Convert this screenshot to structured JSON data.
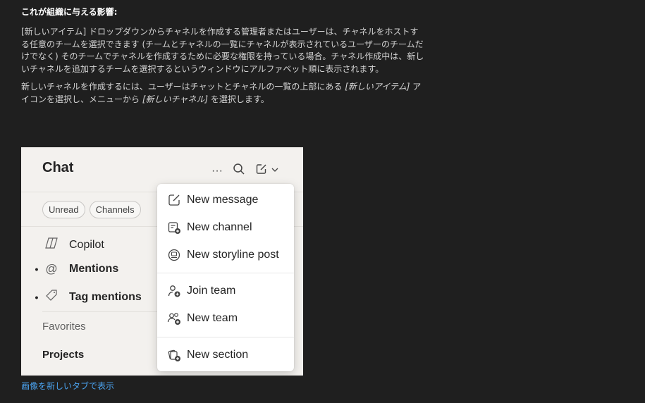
{
  "doc": {
    "heading": "これが組織に与える影響:",
    "para1": "[新しいアイテム] ドロップダウンからチャネルを作成する管理者またはユーザーは、チャネルをホストする任意のチームを選択できます (チームとチャネルの一覧にチャネルが表示されているユーザーのチームだけでなく) そのチームでチャネルを作成するために必要な権限を持っている場合。チャネル作成中は、新しいチャネルを追加するチームを選択するというウィンドウにアルファベット順に表示されます。",
    "para2_before": "新しいチャネルを作成するには、ユーザーはチャットとチャネルの一覧の上部にある ",
    "para2_item": "[新しいアイテム]",
    "para2_mid": " アイコンを選択し、メニューから ",
    "para2_channel": "[新しいチャネル]",
    "para2_after": " を選択します。",
    "link": "画像を新しいタブで表示"
  },
  "screenshot": {
    "title": "Chat",
    "header_icons": [
      "more-icon",
      "search-icon",
      "compose-icon",
      "chevron-down-icon"
    ],
    "more_glyph": "···",
    "filters": [
      "Unread",
      "Channels"
    ],
    "list": {
      "copilot": "Copilot",
      "mentions": "Mentions",
      "tag_mentions": "Tag mentions",
      "favorites": "Favorites",
      "projects": "Projects"
    },
    "menu": {
      "new_message": "New message",
      "new_channel": "New channel",
      "new_storyline_post": "New storyline post",
      "join_team": "Join team",
      "new_team": "New team",
      "new_section": "New section"
    }
  }
}
